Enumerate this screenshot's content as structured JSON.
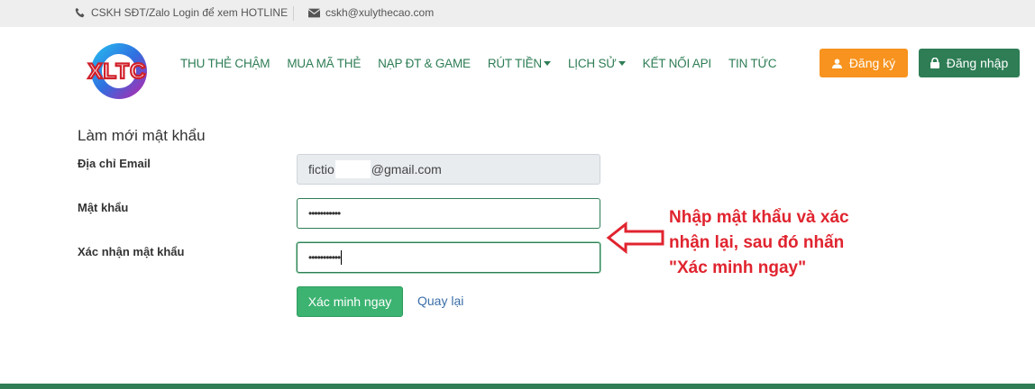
{
  "topbar": {
    "hotline_text": "CSKH SĐT/Zalo Login để xem HOTLINE",
    "email_text": "cskh@xulythecao.com"
  },
  "logo": {
    "text": "XLTC"
  },
  "nav": {
    "items": [
      {
        "label": "THU THẺ CHẬM",
        "dropdown": false
      },
      {
        "label": "MUA MÃ THẺ",
        "dropdown": false
      },
      {
        "label": "NẠP ĐT & GAME",
        "dropdown": false
      },
      {
        "label": "RÚT TIỀN",
        "dropdown": true
      },
      {
        "label": "LỊCH SỬ",
        "dropdown": true
      },
      {
        "label": "KẾT NỐI API",
        "dropdown": false
      },
      {
        "label": "TIN TỨC",
        "dropdown": false
      }
    ]
  },
  "auth": {
    "register_label": "Đăng ký",
    "login_label": "Đăng nhập"
  },
  "form": {
    "title": "Làm mới mật khẩu",
    "email_label": "Địa chỉ Email",
    "email_prefix": "fictio",
    "email_suffix": "@gmail.com",
    "password_label": "Mật khẩu",
    "password_value": "•••••••••••",
    "confirm_label": "Xác nhận mật khẩu",
    "confirm_value": "•••••••••••",
    "submit_label": "Xác minh ngay",
    "back_label": "Quay lại"
  },
  "annotation": {
    "text": "Nhập mật khẩu và xác nhận lại, sau đó nhấn \"Xác minh ngay\""
  },
  "colors": {
    "brand_green": "#2e7d55",
    "orange": "#f7931e",
    "verify_green": "#3cb371",
    "annotation_red": "#e0242f"
  }
}
